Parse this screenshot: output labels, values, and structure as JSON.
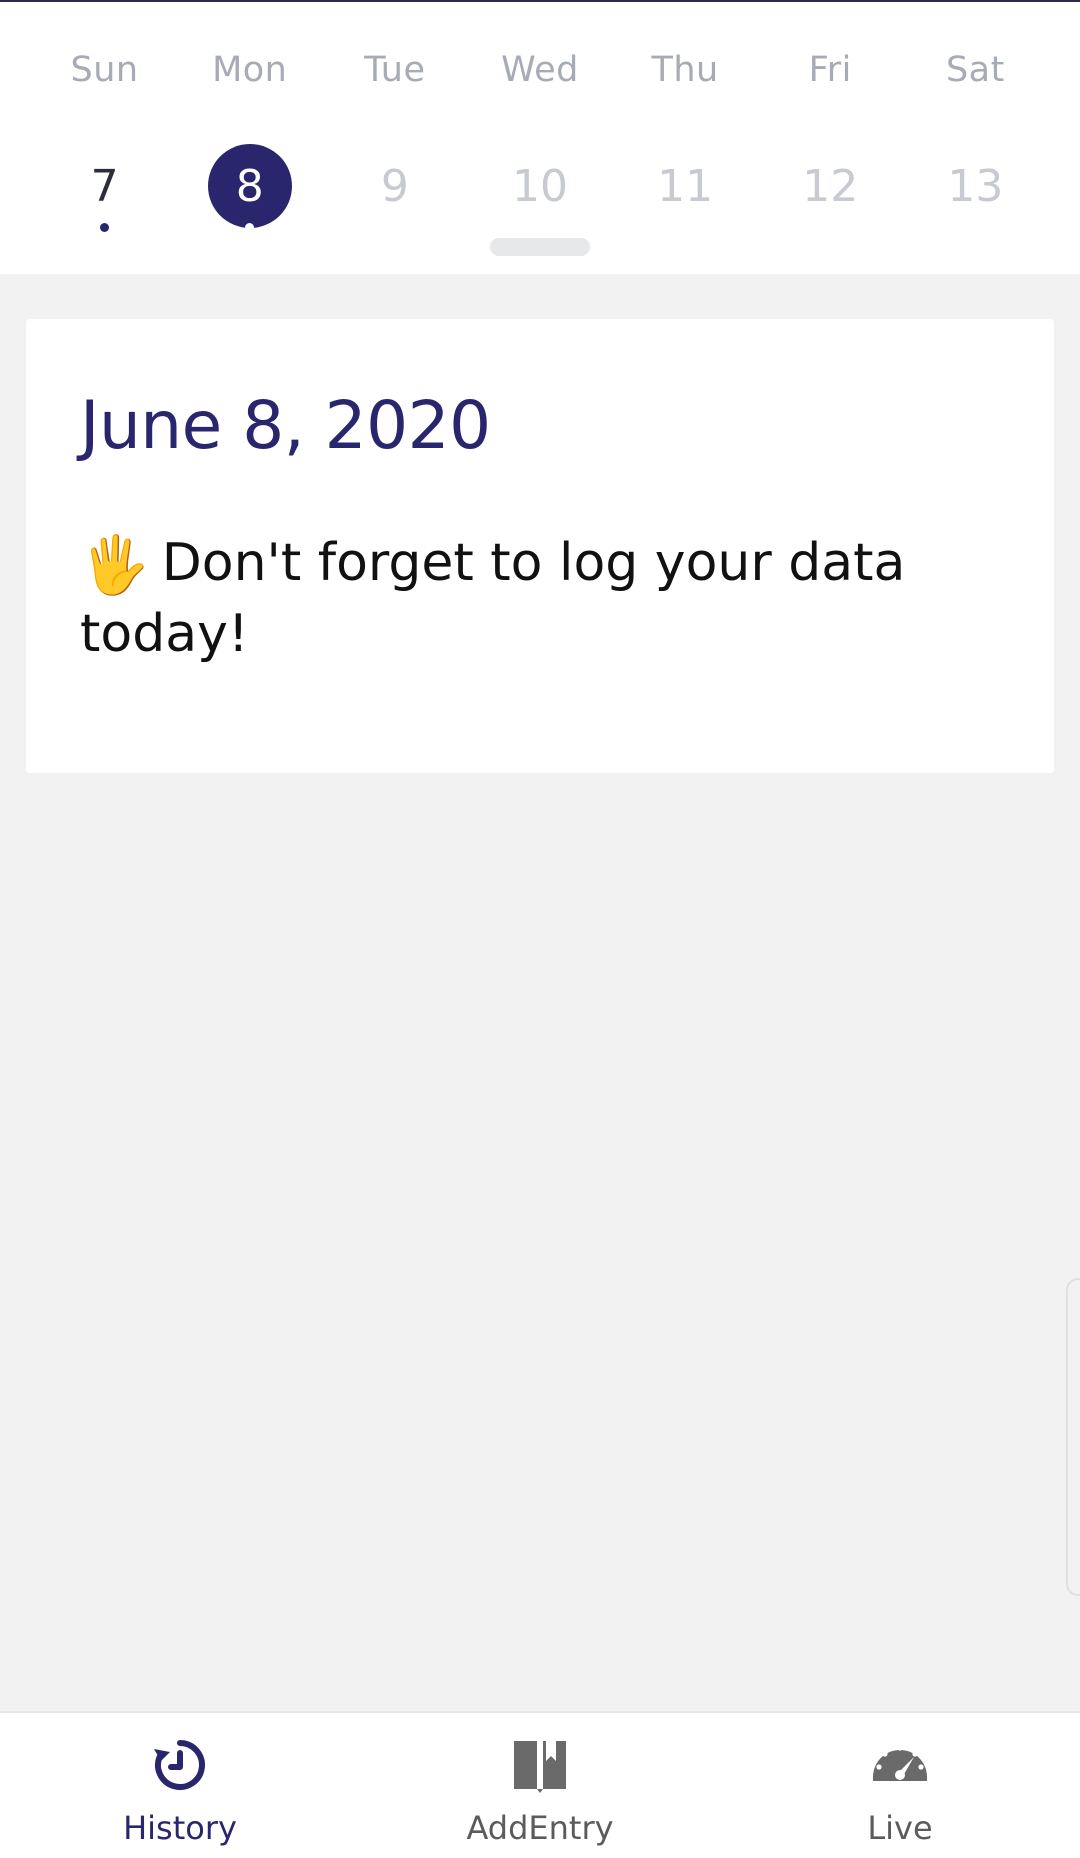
{
  "calendar": {
    "weekdays": [
      "Sun",
      "Mon",
      "Tue",
      "Wed",
      "Thu",
      "Fri",
      "Sat"
    ],
    "dates": [
      "7",
      "8",
      "9",
      "10",
      "11",
      "12",
      "13"
    ],
    "selected_date": "8"
  },
  "card": {
    "date_title": "June 8, 2020",
    "emoji": "🖐",
    "message": "Don't forget to log your data today!"
  },
  "nav": {
    "items": [
      {
        "label": "History",
        "icon": "history-icon"
      },
      {
        "label": "AddEntry",
        "icon": "book-icon"
      },
      {
        "label": "Live",
        "icon": "speedometer-icon"
      }
    ],
    "active": "History"
  },
  "colors": {
    "accent": "#29266e",
    "weekday_text": "#a7abb6",
    "future_date": "#c7cad1",
    "background": "#f2f2f2"
  }
}
